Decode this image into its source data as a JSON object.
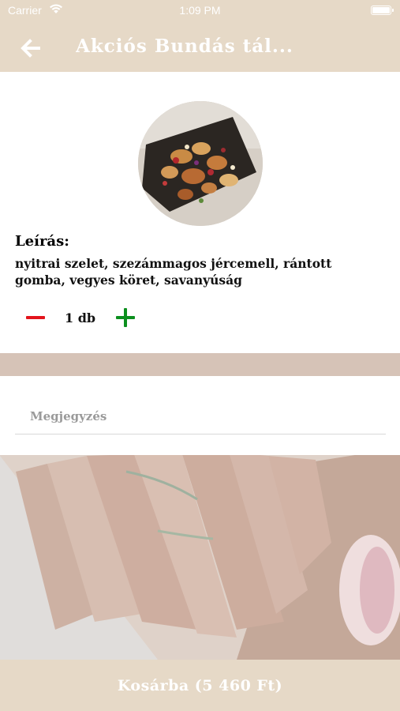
{
  "status_bar": {
    "carrier": "Carrier",
    "time": "1:09 PM",
    "wifi_icon": "wifi-icon",
    "battery_icon": "battery-icon"
  },
  "header": {
    "back_icon": "arrow-left-icon",
    "title": "Akciós Bundás tál..."
  },
  "product": {
    "image_icon": "food-platter-photo",
    "description_heading": "Leírás:",
    "description": "nyitrai szelet, szezámmagos jércemell, rántott gomba, vegyes köret, savanyúság"
  },
  "quantity": {
    "minus_icon": "minus-icon",
    "value": "1 db",
    "plus_icon": "plus-icon"
  },
  "note": {
    "placeholder": "Megjegyzés",
    "value": ""
  },
  "footer": {
    "cart_label": "Kosárba (5 460 Ft)"
  },
  "colors": {
    "header_bg": "#e6d9c7",
    "minus": "#e3141c",
    "plus": "#0c8f1e",
    "text": "#111111"
  }
}
